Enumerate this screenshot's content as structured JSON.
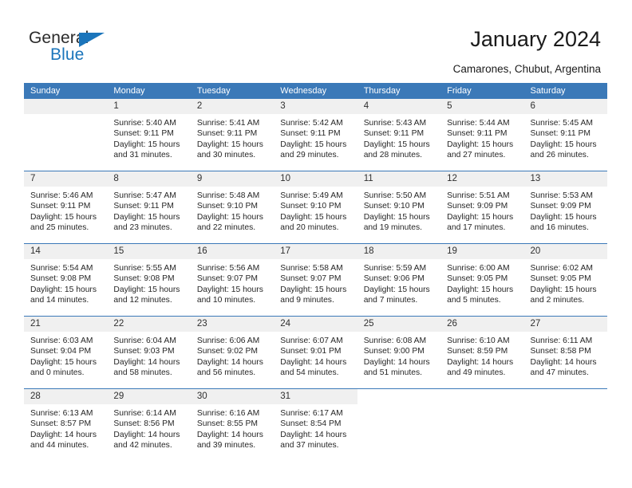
{
  "brand": {
    "name_dark": "General",
    "name_blue": "Blue",
    "accent_color": "#1b75bb"
  },
  "header": {
    "title": "January 2024",
    "subtitle": "Camarones, Chubut, Argentina"
  },
  "theme": {
    "header_row_bg": "#3b79b8",
    "daynum_bg": "#f0f0f0",
    "grid_line": "#3b79b8",
    "text": "#262626"
  },
  "weekday_headers": [
    "Sunday",
    "Monday",
    "Tuesday",
    "Wednesday",
    "Thursday",
    "Friday",
    "Saturday"
  ],
  "weeks": [
    [
      {
        "day": "",
        "sunrise": "",
        "sunset": "",
        "daylight_line1": "",
        "daylight_line2": ""
      },
      {
        "day": "1",
        "sunrise": "Sunrise: 5:40 AM",
        "sunset": "Sunset: 9:11 PM",
        "daylight_line1": "Daylight: 15 hours",
        "daylight_line2": "and 31 minutes."
      },
      {
        "day": "2",
        "sunrise": "Sunrise: 5:41 AM",
        "sunset": "Sunset: 9:11 PM",
        "daylight_line1": "Daylight: 15 hours",
        "daylight_line2": "and 30 minutes."
      },
      {
        "day": "3",
        "sunrise": "Sunrise: 5:42 AM",
        "sunset": "Sunset: 9:11 PM",
        "daylight_line1": "Daylight: 15 hours",
        "daylight_line2": "and 29 minutes."
      },
      {
        "day": "4",
        "sunrise": "Sunrise: 5:43 AM",
        "sunset": "Sunset: 9:11 PM",
        "daylight_line1": "Daylight: 15 hours",
        "daylight_line2": "and 28 minutes."
      },
      {
        "day": "5",
        "sunrise": "Sunrise: 5:44 AM",
        "sunset": "Sunset: 9:11 PM",
        "daylight_line1": "Daylight: 15 hours",
        "daylight_line2": "and 27 minutes."
      },
      {
        "day": "6",
        "sunrise": "Sunrise: 5:45 AM",
        "sunset": "Sunset: 9:11 PM",
        "daylight_line1": "Daylight: 15 hours",
        "daylight_line2": "and 26 minutes."
      }
    ],
    [
      {
        "day": "7",
        "sunrise": "Sunrise: 5:46 AM",
        "sunset": "Sunset: 9:11 PM",
        "daylight_line1": "Daylight: 15 hours",
        "daylight_line2": "and 25 minutes."
      },
      {
        "day": "8",
        "sunrise": "Sunrise: 5:47 AM",
        "sunset": "Sunset: 9:11 PM",
        "daylight_line1": "Daylight: 15 hours",
        "daylight_line2": "and 23 minutes."
      },
      {
        "day": "9",
        "sunrise": "Sunrise: 5:48 AM",
        "sunset": "Sunset: 9:10 PM",
        "daylight_line1": "Daylight: 15 hours",
        "daylight_line2": "and 22 minutes."
      },
      {
        "day": "10",
        "sunrise": "Sunrise: 5:49 AM",
        "sunset": "Sunset: 9:10 PM",
        "daylight_line1": "Daylight: 15 hours",
        "daylight_line2": "and 20 minutes."
      },
      {
        "day": "11",
        "sunrise": "Sunrise: 5:50 AM",
        "sunset": "Sunset: 9:10 PM",
        "daylight_line1": "Daylight: 15 hours",
        "daylight_line2": "and 19 minutes."
      },
      {
        "day": "12",
        "sunrise": "Sunrise: 5:51 AM",
        "sunset": "Sunset: 9:09 PM",
        "daylight_line1": "Daylight: 15 hours",
        "daylight_line2": "and 17 minutes."
      },
      {
        "day": "13",
        "sunrise": "Sunrise: 5:53 AM",
        "sunset": "Sunset: 9:09 PM",
        "daylight_line1": "Daylight: 15 hours",
        "daylight_line2": "and 16 minutes."
      }
    ],
    [
      {
        "day": "14",
        "sunrise": "Sunrise: 5:54 AM",
        "sunset": "Sunset: 9:08 PM",
        "daylight_line1": "Daylight: 15 hours",
        "daylight_line2": "and 14 minutes."
      },
      {
        "day": "15",
        "sunrise": "Sunrise: 5:55 AM",
        "sunset": "Sunset: 9:08 PM",
        "daylight_line1": "Daylight: 15 hours",
        "daylight_line2": "and 12 minutes."
      },
      {
        "day": "16",
        "sunrise": "Sunrise: 5:56 AM",
        "sunset": "Sunset: 9:07 PM",
        "daylight_line1": "Daylight: 15 hours",
        "daylight_line2": "and 10 minutes."
      },
      {
        "day": "17",
        "sunrise": "Sunrise: 5:58 AM",
        "sunset": "Sunset: 9:07 PM",
        "daylight_line1": "Daylight: 15 hours",
        "daylight_line2": "and 9 minutes."
      },
      {
        "day": "18",
        "sunrise": "Sunrise: 5:59 AM",
        "sunset": "Sunset: 9:06 PM",
        "daylight_line1": "Daylight: 15 hours",
        "daylight_line2": "and 7 minutes."
      },
      {
        "day": "19",
        "sunrise": "Sunrise: 6:00 AM",
        "sunset": "Sunset: 9:05 PM",
        "daylight_line1": "Daylight: 15 hours",
        "daylight_line2": "and 5 minutes."
      },
      {
        "day": "20",
        "sunrise": "Sunrise: 6:02 AM",
        "sunset": "Sunset: 9:05 PM",
        "daylight_line1": "Daylight: 15 hours",
        "daylight_line2": "and 2 minutes."
      }
    ],
    [
      {
        "day": "21",
        "sunrise": "Sunrise: 6:03 AM",
        "sunset": "Sunset: 9:04 PM",
        "daylight_line1": "Daylight: 15 hours",
        "daylight_line2": "and 0 minutes."
      },
      {
        "day": "22",
        "sunrise": "Sunrise: 6:04 AM",
        "sunset": "Sunset: 9:03 PM",
        "daylight_line1": "Daylight: 14 hours",
        "daylight_line2": "and 58 minutes."
      },
      {
        "day": "23",
        "sunrise": "Sunrise: 6:06 AM",
        "sunset": "Sunset: 9:02 PM",
        "daylight_line1": "Daylight: 14 hours",
        "daylight_line2": "and 56 minutes."
      },
      {
        "day": "24",
        "sunrise": "Sunrise: 6:07 AM",
        "sunset": "Sunset: 9:01 PM",
        "daylight_line1": "Daylight: 14 hours",
        "daylight_line2": "and 54 minutes."
      },
      {
        "day": "25",
        "sunrise": "Sunrise: 6:08 AM",
        "sunset": "Sunset: 9:00 PM",
        "daylight_line1": "Daylight: 14 hours",
        "daylight_line2": "and 51 minutes."
      },
      {
        "day": "26",
        "sunrise": "Sunrise: 6:10 AM",
        "sunset": "Sunset: 8:59 PM",
        "daylight_line1": "Daylight: 14 hours",
        "daylight_line2": "and 49 minutes."
      },
      {
        "day": "27",
        "sunrise": "Sunrise: 6:11 AM",
        "sunset": "Sunset: 8:58 PM",
        "daylight_line1": "Daylight: 14 hours",
        "daylight_line2": "and 47 minutes."
      }
    ],
    [
      {
        "day": "28",
        "sunrise": "Sunrise: 6:13 AM",
        "sunset": "Sunset: 8:57 PM",
        "daylight_line1": "Daylight: 14 hours",
        "daylight_line2": "and 44 minutes."
      },
      {
        "day": "29",
        "sunrise": "Sunrise: 6:14 AM",
        "sunset": "Sunset: 8:56 PM",
        "daylight_line1": "Daylight: 14 hours",
        "daylight_line2": "and 42 minutes."
      },
      {
        "day": "30",
        "sunrise": "Sunrise: 6:16 AM",
        "sunset": "Sunset: 8:55 PM",
        "daylight_line1": "Daylight: 14 hours",
        "daylight_line2": "and 39 minutes."
      },
      {
        "day": "31",
        "sunrise": "Sunrise: 6:17 AM",
        "sunset": "Sunset: 8:54 PM",
        "daylight_line1": "Daylight: 14 hours",
        "daylight_line2": "and 37 minutes."
      },
      {
        "day": "",
        "sunrise": "",
        "sunset": "",
        "daylight_line1": "",
        "daylight_line2": ""
      },
      {
        "day": "",
        "sunrise": "",
        "sunset": "",
        "daylight_line1": "",
        "daylight_line2": ""
      },
      {
        "day": "",
        "sunrise": "",
        "sunset": "",
        "daylight_line1": "",
        "daylight_line2": ""
      }
    ]
  ]
}
